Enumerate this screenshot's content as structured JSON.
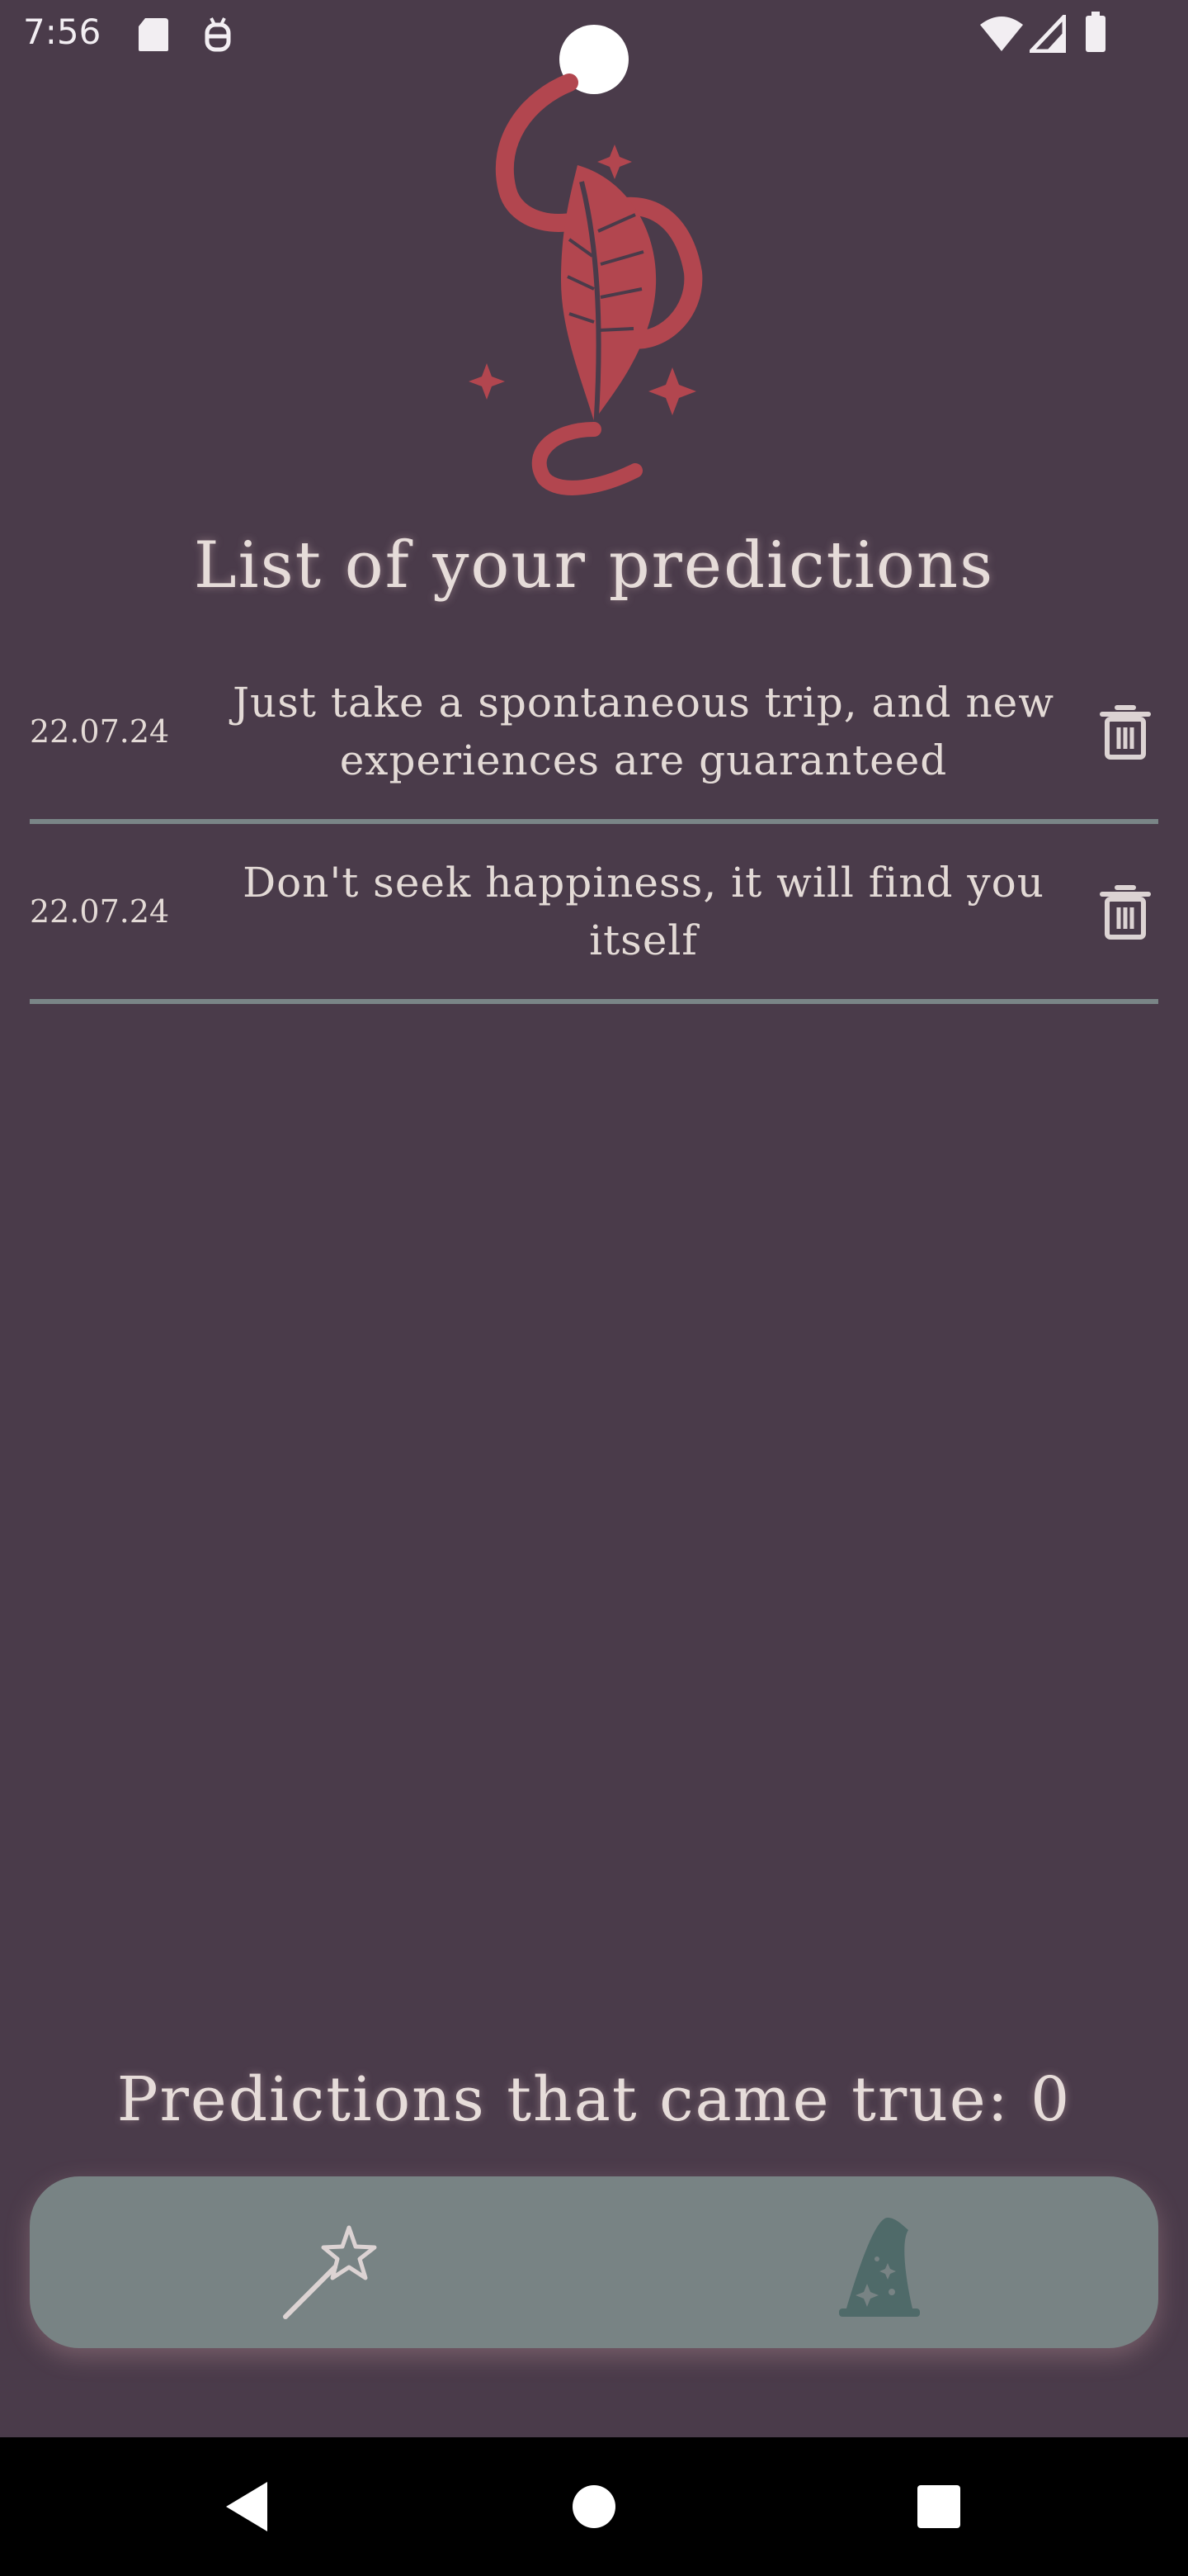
{
  "status_bar": {
    "time": "7:56",
    "icons": [
      "sd-card-icon",
      "debug-icon",
      "wifi-icon",
      "signal-icon",
      "battery-icon"
    ]
  },
  "header": {
    "logo_icon": "feather-quill-logo-icon",
    "title": "List of your predictions"
  },
  "predictions": [
    {
      "date": "22.07.24",
      "text": "Just take a spontaneous trip, and new experiences are guaranteed",
      "delete_icon": "trash-icon"
    },
    {
      "date": "22.07.24",
      "text": "Don't seek happiness, it will find you itself",
      "delete_icon": "trash-icon"
    }
  ],
  "counter": {
    "label": "Predictions that came true: 0"
  },
  "bottom_nav": {
    "items": [
      {
        "icon": "magic-wand-icon",
        "selected": false
      },
      {
        "icon": "wizard-hat-icon",
        "selected": true
      }
    ]
  },
  "system_nav": {
    "buttons": [
      "back-icon",
      "home-icon",
      "recents-icon"
    ]
  },
  "colors": {
    "background": "#4a3b4a",
    "accent": "#b2464f",
    "text": "#e3dad6",
    "divider": "#7a8587",
    "nav_bar": "#788384",
    "selected_icon": "#4f6a69"
  }
}
